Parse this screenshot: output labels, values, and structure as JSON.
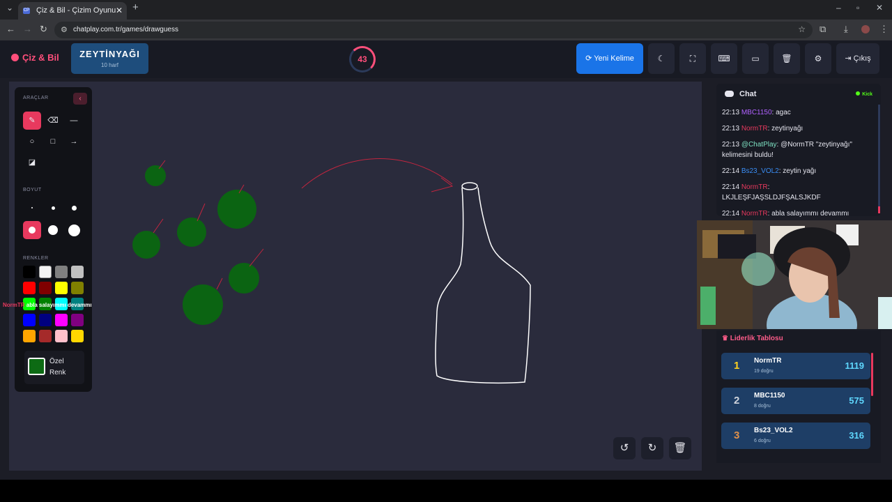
{
  "browser": {
    "tab_title": "Çiz & Bil - Çizim Oyunu",
    "favicon_text": "CP",
    "url": "chatplay.com.tr/games/drawguess"
  },
  "header": {
    "brand": "Çiz & Bil",
    "word": "ZEYTİNYAĞI",
    "word_count": "10 harf",
    "timer": "43",
    "new_word_label": "Yeni Kelime",
    "exit_label": "Çıkış"
  },
  "tools": {
    "section_tools": "ARAÇLAR",
    "section_size": "BOYUT",
    "section_colors": "RENKLER",
    "custom_color_label_1": "Özel",
    "custom_color_label_2": "Renk",
    "palette": [
      "#000000",
      "#f4f4f4",
      "#808080",
      "#c0c0c0",
      "#ff0000",
      "#800000",
      "#ffff00",
      "#808000",
      "#00ff00",
      "#008000",
      "#00ffff",
      "#008080",
      "#0000ff",
      "#000080",
      "#ff00ff",
      "#800080",
      "#ffa500",
      "#a52a2a",
      "#ffc0cb",
      "#ffd700"
    ],
    "selected_color": "#0d6b14"
  },
  "toast": {
    "name": "NormTR",
    "text": "abla salayımmı devammı"
  },
  "chat": {
    "title": "Chat",
    "platform": "Kick",
    "messages": [
      {
        "time": "22:13",
        "user": "MBC1150",
        "color": "#b061ff",
        "text": ": agac"
      },
      {
        "time": "22:13",
        "user": "NormTR",
        "color": "#e8395e",
        "text": ": zeytinyağı"
      },
      {
        "time": "22:13",
        "user": "@ChatPlay",
        "color": "#7fe3c4",
        "text": ": @NormTR \"zeytinyağı\" kelimesini buldu!"
      },
      {
        "time": "22:14",
        "user": "Bs23_VOL2",
        "color": "#3a8ef6",
        "text": ": zeytin yağı"
      },
      {
        "time": "22:14",
        "user": "NormTR",
        "color": "#e8395e",
        "text": ": LKJLEŞFJAŞSLDJFŞALSJKDF"
      },
      {
        "time": "22:14",
        "user": "NormTR",
        "color": "#e8395e",
        "text": ": abla salayımmı devammı"
      }
    ]
  },
  "leaderboard": {
    "title": "Liderlik Tablosu",
    "rows": [
      {
        "rank": "1",
        "name": "NormTR",
        "correct": "19 doğru",
        "score": "1119",
        "rank_color": "#ffd21f"
      },
      {
        "rank": "2",
        "name": "MBC1150",
        "correct": "8 doğru",
        "score": "575",
        "rank_color": "#d0d4dc"
      },
      {
        "rank": "3",
        "name": "Bs23_VOL2",
        "correct": "6 doğru",
        "score": "316",
        "rank_color": "#e0914a"
      }
    ]
  }
}
